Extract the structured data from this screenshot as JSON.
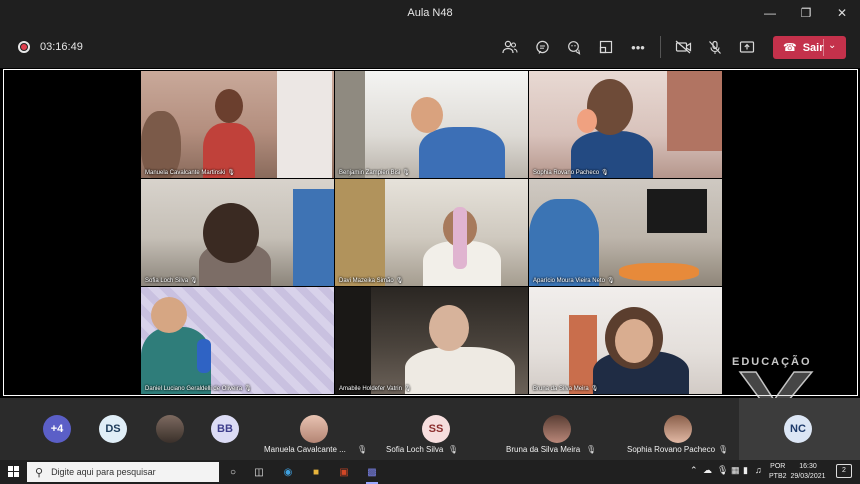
{
  "window": {
    "title": "Aula N48"
  },
  "toolbar": {
    "recording_time": "03:16:49",
    "leave_label": "Sair"
  },
  "icons": {
    "participants": "people-icon",
    "chat": "chat-icon",
    "reactions": "reactions-icon",
    "rooms": "rooms-icon",
    "more": "more-icon",
    "camera_off": "camera-off-icon",
    "mic_off": "mic-off-icon",
    "share": "share-icon"
  },
  "tiles": [
    {
      "name": "Manuela Cavalcante Martinski"
    },
    {
      "name": "Benjamin Zampieri Bisi"
    },
    {
      "name": "Sophia Rovano Pacheco"
    },
    {
      "name": "Sofia Loch Silva"
    },
    {
      "name": "Davi Mazeika Simão"
    },
    {
      "name": "Aparício Moura Vieira Neto"
    },
    {
      "name": "Daniel Luciano Geraldelli de Oliveira"
    },
    {
      "name": "Amabile Holdefer Vatrin"
    },
    {
      "name": "Bruna da Silva Meira"
    }
  ],
  "watermark": {
    "text": "EDUCAÇÃO"
  },
  "strip": {
    "more_count": "+4",
    "initials": [
      "DS",
      "BB",
      "SS",
      "NC"
    ],
    "participants": [
      {
        "name": "Manuela Cavalcante ..."
      },
      {
        "name": "Sofia Loch Silva"
      },
      {
        "name": "Bruna da Silva Meira"
      },
      {
        "name": "Sophia Rovano Pacheco"
      }
    ]
  },
  "taskbar": {
    "search_placeholder": "Digite aqui para pesquisar",
    "lang_line1": "POR",
    "lang_line2": "PTB2",
    "time": "16:30",
    "date": "29/03/2021",
    "notifications": "2"
  },
  "colors": {
    "leave_button": "#c4314b",
    "chrome": "#1f1f1f",
    "strip": "#2b2b2b"
  }
}
